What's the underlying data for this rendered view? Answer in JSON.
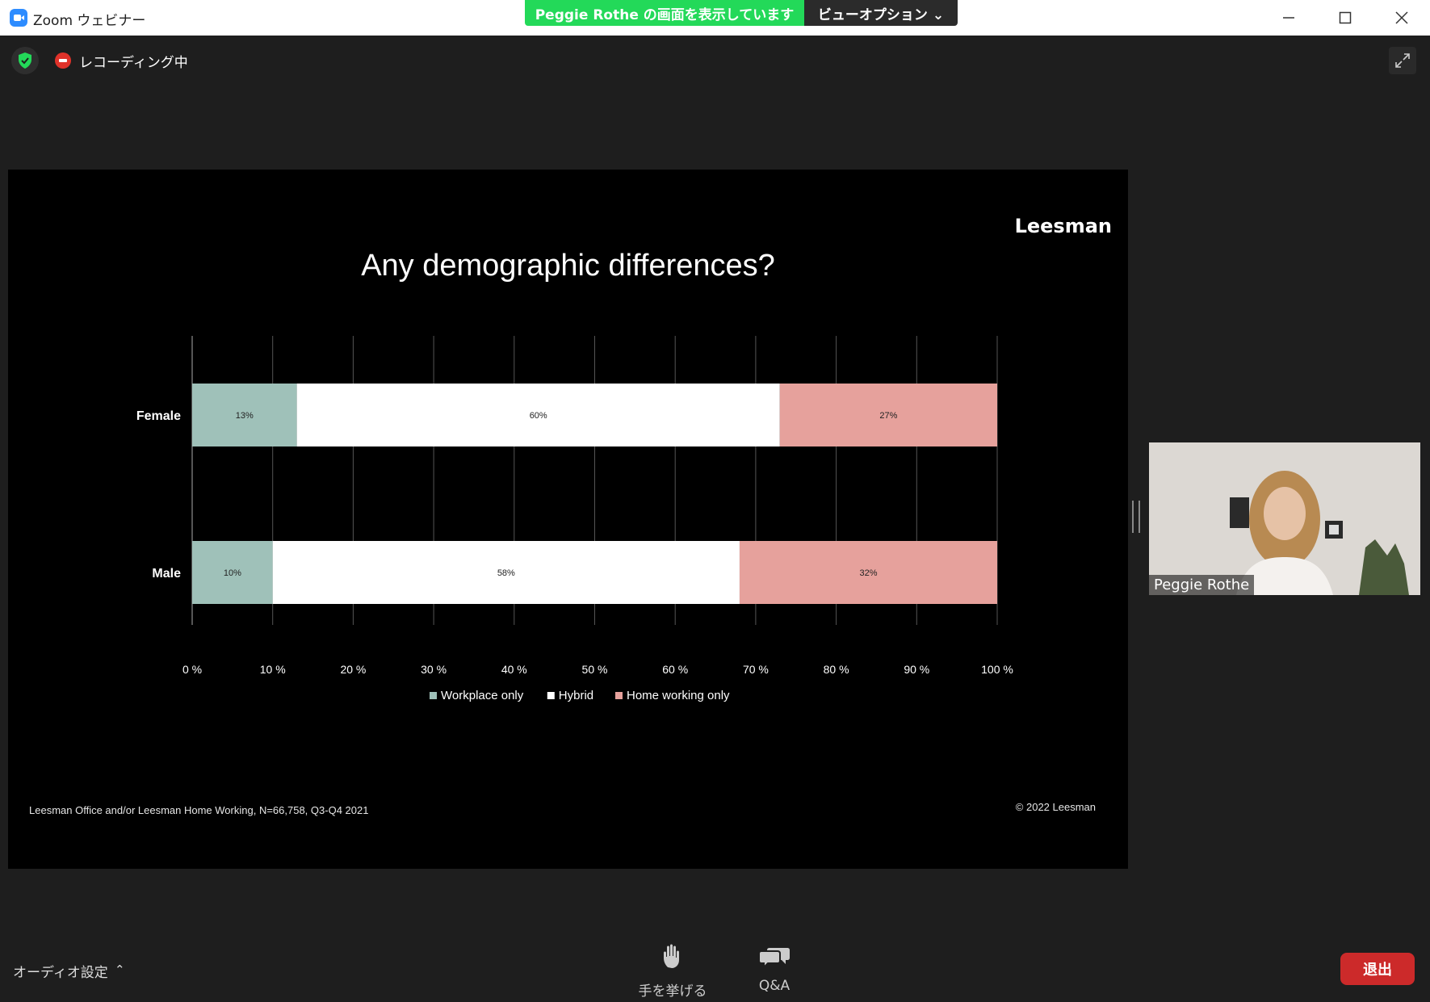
{
  "window": {
    "title": "Zoom ウェビナー"
  },
  "share_banner": {
    "text": "Peggie  Rothe の画面を表示しています",
    "view_options": "ビューオプション ⌄"
  },
  "recording": {
    "label": "レコーディング中"
  },
  "slide": {
    "logo": "Leesman",
    "title": "Any demographic differences?",
    "footnote": "Leesman Office and/or Leesman Home Working, N=66,758, Q3-Q4 2021",
    "copyright": "© 2022 Leesman"
  },
  "chart_data": {
    "type": "bar",
    "orientation": "horizontal",
    "stacked": true,
    "categories": [
      "Female",
      "Male"
    ],
    "series": [
      {
        "name": "Workplace only",
        "values": [
          13,
          10
        ],
        "labels": [
          "13%",
          "10%"
        ],
        "color": "#9fc1b9"
      },
      {
        "name": "Hybrid",
        "values": [
          60,
          58
        ],
        "labels": [
          "60%",
          "58%"
        ],
        "color": "#ffffff"
      },
      {
        "name": "Home working only",
        "values": [
          27,
          32
        ],
        "labels": [
          "27%",
          "32%"
        ],
        "color": "#e6a19c"
      }
    ],
    "xlim": [
      0,
      100
    ],
    "xticks": [
      "0 %",
      "10 %",
      "20 %",
      "30 %",
      "40 %",
      "50 %",
      "60 %",
      "70 %",
      "80 %",
      "90 %",
      "100 %"
    ],
    "grid": true,
    "legend": "bottom"
  },
  "participant": {
    "name": "Peggie Rothe"
  },
  "bottom": {
    "audio": "オーディオ設定",
    "raise_hand": "手を挙げる",
    "qa": "Q&A",
    "leave": "退出"
  },
  "colors": {
    "banner": "#23d959",
    "leave": "#cc2a2a",
    "accent": "#2d8cff"
  }
}
